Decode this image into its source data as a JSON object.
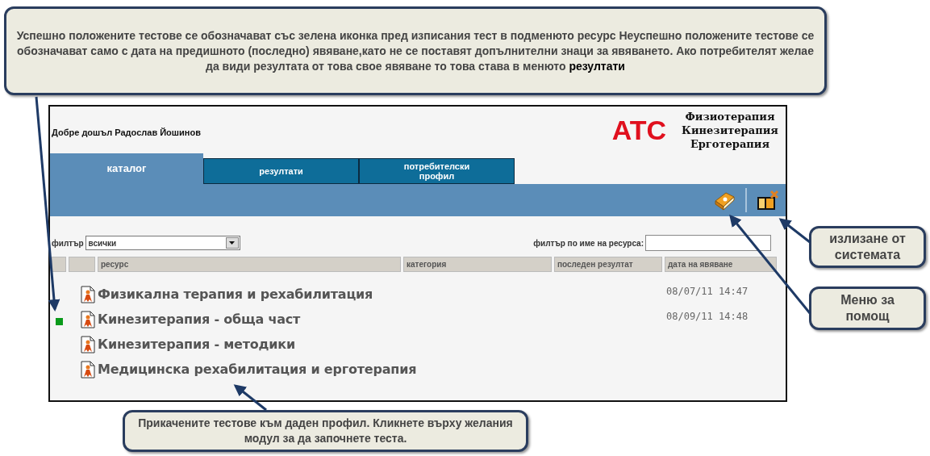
{
  "callouts": [
    {
      "text": "Успешно положените тестове се обозначават със зелена иконка пред изписания тест в подменюто ресурс Неуспешно положените тестове се обозначават само с дата на предишното (последно) явяване,като не се поставят допълнителни знаци за явяването. Ако потребителят желае да види резултата от това свое явяване то това става в менюто **резултати**"
    },
    {
      "text": "излизане от системата"
    },
    {
      "text": "Меню за помощ"
    },
    {
      "text": "Прикачените тестове към даден профил. Кликнете върху желания модул за да започнете теста."
    }
  ],
  "header": {
    "welcome": "Добре дошъл Радослав Йошинов",
    "logo": "ATC",
    "subtitle_lines": [
      "Физиотерапия",
      "Кинезитерапия",
      "Ерготерапия"
    ]
  },
  "tabs": [
    {
      "label": "каталог",
      "selected": true
    },
    {
      "label": "резултати",
      "selected": false
    },
    {
      "label": "потребителски профил",
      "selected": false
    }
  ],
  "filter": {
    "label": "филтър",
    "value": "всички"
  },
  "name_filter": {
    "label": "филтър по име на ресурса:"
  },
  "table": {
    "columns": [
      "ресурс",
      "категория",
      "последен резултат",
      "дата на явяване"
    ],
    "rows": [
      {
        "resource": "Физикална терапия и рехабилитация",
        "passed": false,
        "date": "08/07/11 14:47"
      },
      {
        "resource": "Кинезитерапия - обща част",
        "passed": true,
        "date": "08/09/11 14:48"
      },
      {
        "resource": "Кинезитерапия - методики",
        "passed": false
      },
      {
        "resource": "Медицинска рехабилитация и ерготерапия",
        "passed": false
      }
    ]
  }
}
